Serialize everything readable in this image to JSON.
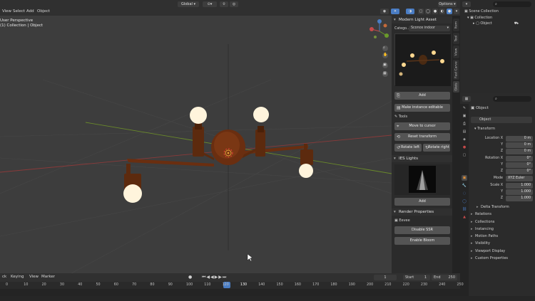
{
  "header": {
    "menus": [
      "View",
      "Select",
      "Add",
      "Object"
    ],
    "orientation": "Global",
    "options": "Options"
  },
  "viewport": {
    "perspective": "User Perspective",
    "collection": "(1) Collection | Object"
  },
  "npanel": {
    "title": "Modern Light Asset",
    "category_label": "Catego...",
    "category_value": "Sconce indoor",
    "add": "Add",
    "make_editable": "Make instance editable",
    "tools": "Tools",
    "move_to_cursor": "Move to cursor",
    "reset_transform": "Reset transform",
    "rotate_left": "Rotate left",
    "rotate_right": "Rotate right",
    "ies_title": "IES Lights",
    "ies_add": "Add",
    "render_title": "Render Properties",
    "render_engine": "Eevee",
    "disable_ssr": "Disable SSR",
    "enable_bloom": "Enable Bloom",
    "tabs": [
      "Item",
      "Tool",
      "View",
      "Fast Carve",
      "Gleis"
    ]
  },
  "outliner": {
    "scene_collection": "Scene Collection",
    "collection": "Collection",
    "object": "Object"
  },
  "properties": {
    "object_name": "Object",
    "object_field": "Object",
    "transform": "Transform",
    "location_x_label": "Location X",
    "location_x": "0 m",
    "location_y_label": "Y",
    "location_y": "0 m",
    "location_z_label": "Z",
    "location_z": "0 m",
    "rotation_x_label": "Rotation X",
    "rotation_x": "0°",
    "rotation_y_label": "Y",
    "rotation_y": "0°",
    "rotation_z_label": "Z",
    "rotation_z": "0°",
    "mode_label": "Mode",
    "mode": "XYZ Euler",
    "scale_x_label": "Scale X",
    "scale_x": "1.000",
    "scale_y_label": "Y",
    "scale_y": "1.000",
    "scale_z_label": "Z",
    "scale_z": "1.000",
    "delta_transform": "Delta Transform",
    "sections": [
      "Relations",
      "Collections",
      "Instancing",
      "Motion Paths",
      "Visibility",
      "Viewport Display",
      "Custom Properties"
    ]
  },
  "timeline": {
    "menus": [
      "ck",
      "Keying",
      "View",
      "Marker"
    ],
    "current_frame": "1",
    "start_label": "Start",
    "start": "1",
    "end_label": "End",
    "end": "250",
    "ticks": [
      "0",
      "10",
      "20",
      "30",
      "40",
      "50",
      "60",
      "70",
      "80",
      "90",
      "100",
      "110",
      "120",
      "130",
      "140",
      "150",
      "160",
      "170",
      "180",
      "190",
      "200",
      "210",
      "220",
      "230",
      "240",
      "250"
    ]
  },
  "colors": {
    "viewport_bg": "#3d3d3d",
    "panel_bg": "#2b2b2b",
    "accent_blue": "#4a7dc4",
    "x_axis": "#8a3a3a",
    "y_axis": "#6a8a2a",
    "lamp_body": "#6a2e10",
    "bulb": "#fff4dc"
  }
}
